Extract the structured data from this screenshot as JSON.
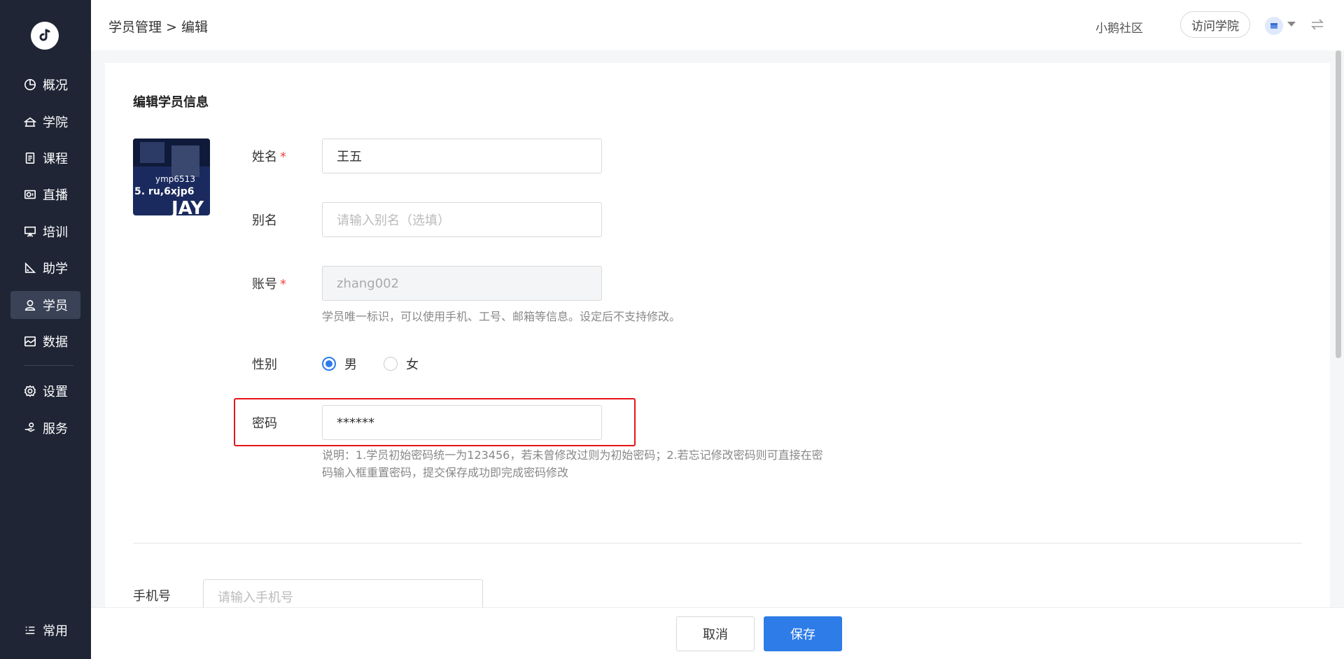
{
  "sidebar": {
    "items": [
      {
        "label": "概况",
        "icon": "pie-chart-icon"
      },
      {
        "label": "学院",
        "icon": "academy-icon"
      },
      {
        "label": "课程",
        "icon": "document-icon"
      },
      {
        "label": "直播",
        "icon": "camera-icon"
      },
      {
        "label": "培训",
        "icon": "presentation-icon"
      },
      {
        "label": "助学",
        "icon": "ruler-icon"
      },
      {
        "label": "学员",
        "icon": "user-icon",
        "active": true
      },
      {
        "label": "数据",
        "icon": "image-chart-icon"
      },
      {
        "label": "设置",
        "icon": "gear-icon"
      },
      {
        "label": "服务",
        "icon": "service-hand-icon"
      }
    ],
    "bottom_label": "常用"
  },
  "header": {
    "breadcrumb": "学员管理 > 编辑",
    "community": "小鹅社区",
    "visit_button": "访问学院"
  },
  "form": {
    "section_title": "编辑学员信息",
    "avatar_text": {
      "line1": "ymp6513",
      "line2": "5. ru,6xjp6",
      "line3": "JAY"
    },
    "name_label": "姓名",
    "name_value": "王五",
    "alias_label": "别名",
    "alias_placeholder": "请输入别名（选填）",
    "account_label": "账号",
    "account_value": "zhang002",
    "account_help": "学员唯一标识，可以使用手机、工号、邮箱等信息。设定后不支持修改。",
    "gender_label": "性别",
    "gender_options": [
      "男",
      "女"
    ],
    "gender_selected": "男",
    "password_label": "密码",
    "password_value": "******",
    "password_help_line1": "说明：1.学员初始密码统一为123456，若未曾修改过则为初始密码；2.若忘记修改密码则可直接在密",
    "password_help_line2": "码输入框重置密码，提交保存成功即完成密码修改",
    "phone_label": "手机号",
    "phone_placeholder": "请输入手机号"
  },
  "footer": {
    "cancel_label": "取消",
    "save_label": "保存"
  },
  "colors": {
    "sidebar_bg": "#1f2535",
    "primary": "#2d7ce8",
    "highlight": "#e5141a"
  }
}
